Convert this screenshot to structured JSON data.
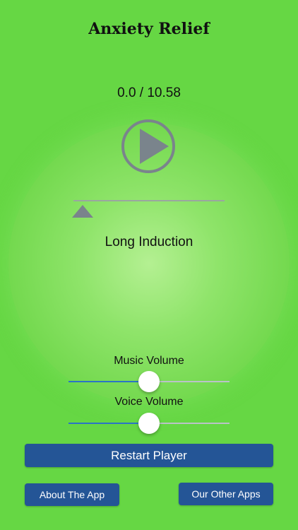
{
  "app": {
    "title": "Anxiety Relief"
  },
  "player": {
    "time_display": "0.0 / 10.58",
    "track_name": "Long Induction",
    "play_icon": "play-icon",
    "progress": 0.0
  },
  "music": {
    "label": "Music Volume",
    "level": 0.5
  },
  "voice": {
    "label": "Voice Volume",
    "level": 0.5
  },
  "buttons": {
    "restart": "Restart Player",
    "about": "About The App",
    "other_apps": "Our Other Apps"
  },
  "colors": {
    "background": "#66d744",
    "button": "#245596",
    "slider_fill": "#2b74c6"
  }
}
